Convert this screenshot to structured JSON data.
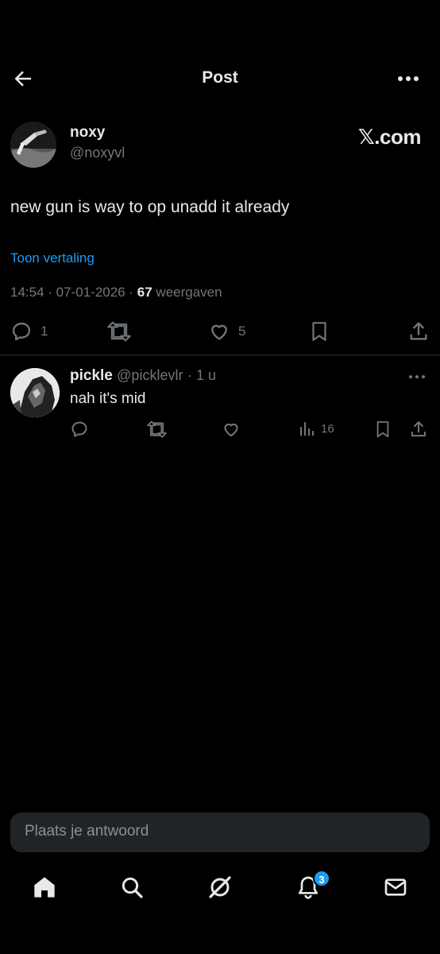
{
  "header": {
    "title": "Post"
  },
  "post": {
    "author_name": "noxy",
    "author_handle": "@noxyvl",
    "brand": "𝕏.com",
    "text": "new gun is way to op unadd it already",
    "translate_label": "Toon vertaling",
    "time": "14:54",
    "date": "07-01-2026",
    "views_count": "67",
    "views_label": "weergaven",
    "reply_count": "1",
    "like_count": "5"
  },
  "reply": {
    "author_name": "pickle",
    "author_handle": "@picklevlr",
    "time_ago": "1 u",
    "text": "nah it's mid",
    "views_count": "16"
  },
  "compose": {
    "placeholder": "Plaats je antwoord"
  },
  "tabbar": {
    "notification_badge": "3",
    "items": [
      "home-icon",
      "search-icon",
      "grok-icon",
      "bell-icon",
      "mail-icon"
    ]
  },
  "colors": {
    "accent": "#1d9bf0",
    "muted": "#71767b",
    "text": "#e7e9ea",
    "background": "#000000"
  }
}
